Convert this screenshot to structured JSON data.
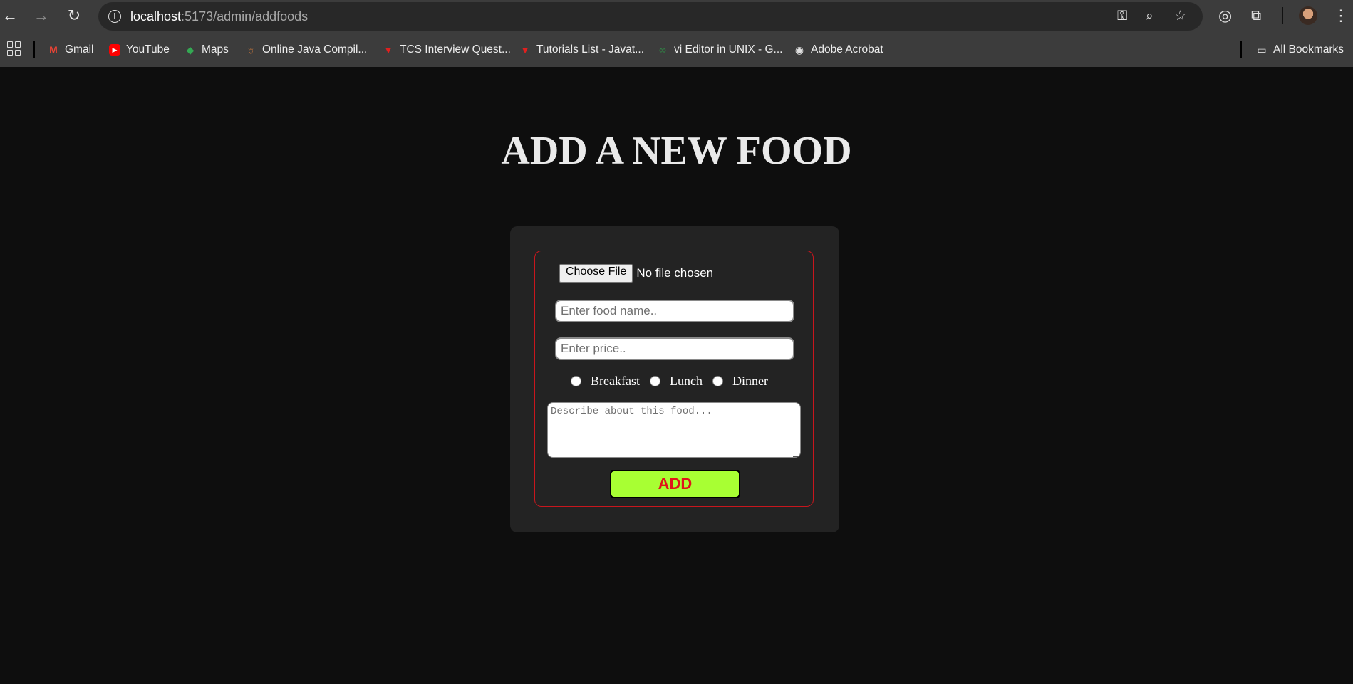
{
  "browser": {
    "url_host": "localhost",
    "url_path": ":5173/admin/addfoods",
    "nav": {
      "back": "←",
      "forward": "→",
      "reload": "↻"
    },
    "toolbar_icons": [
      "key-icon",
      "zoom-icon",
      "star-icon",
      "target-icon",
      "extensions-icon",
      "avatar",
      "menu-icon"
    ]
  },
  "bookmarks": {
    "items": [
      {
        "label": "Gmail",
        "icon": "M",
        "color": "#ea4335"
      },
      {
        "label": "YouTube",
        "icon": "▶",
        "color": "#ff0000"
      },
      {
        "label": "Maps",
        "icon": "◆",
        "color": "#34a853"
      },
      {
        "label": "Online Java Compil...",
        "icon": "☼",
        "color": "#e8833a"
      },
      {
        "label": "TCS Interview Quest...",
        "icon": "▼",
        "color": "#e0201f"
      },
      {
        "label": "Tutorials List - Javat...",
        "icon": "▼",
        "color": "#e0201f"
      },
      {
        "label": "vi Editor in UNIX - G...",
        "icon": "∞",
        "color": "#2f8d46"
      },
      {
        "label": "Adobe Acrobat",
        "icon": "◉",
        "color": "#e0e0e0"
      }
    ],
    "all_bookmarks": "All Bookmarks"
  },
  "page": {
    "title": "ADD A NEW FOOD",
    "form": {
      "file_button": "Choose File",
      "file_status": "No file chosen",
      "food_name_placeholder": "Enter food name..",
      "price_placeholder": "Enter price..",
      "meal_options": [
        "Breakfast",
        "Lunch",
        "Dinner"
      ],
      "description_placeholder": "Describe about this food...",
      "submit_label": "ADD"
    }
  },
  "colors": {
    "background": "#0e0e0e",
    "card": "#232323",
    "form_border": "#c8161d",
    "button_bg": "#a8ff33",
    "button_text": "#e0151a"
  }
}
